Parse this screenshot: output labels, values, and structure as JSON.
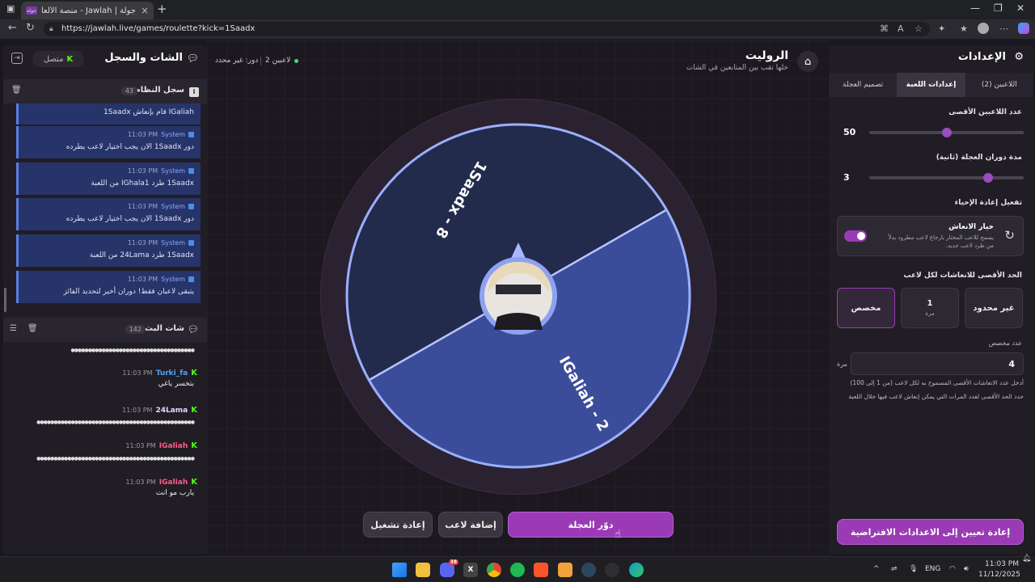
{
  "browser": {
    "tab_title": "جولة | Jawlah - منصة الألعاب التفاعلية",
    "tab_favicon": "جولة",
    "url": "https://jawlah.live/games/roulette?kick=1Saadx"
  },
  "left": {
    "title": "الشات والسجل",
    "online_label": "متصل",
    "system_log": {
      "title": "سجل النظام",
      "count": "43"
    },
    "system_messages": [
      {
        "text": "IGaliah قام بإنعاش 1Saadx",
        "sender": "",
        "time": ""
      },
      {
        "sender": "System",
        "time": "11:03 PM",
        "text": "دور 1Saadx الان يجب اختيار لاعب يطرده"
      },
      {
        "sender": "System",
        "time": "11:03 PM",
        "text": "1Saadx طرد IGhala1 من اللعبة"
      },
      {
        "sender": "System",
        "time": "11:03 PM",
        "text": "دور 1Saadx الان يجب اختيار لاعب يطرده"
      },
      {
        "sender": "System",
        "time": "11:03 PM",
        "text": "1Saadx طرد 24Lama من اللعبة"
      },
      {
        "sender": "System",
        "time": "11:03 PM",
        "text": "يتبقى لاعبان فقط! دوران أخير لتحديد الفائز"
      }
    ],
    "stream_chat": {
      "title": "شات البث",
      "count": "142"
    },
    "chat_messages": [
      {
        "name": "Turki_fa",
        "time": "11:03 PM",
        "text": "بتخسر ياغي",
        "color": "#4aa3ff"
      },
      {
        "name": "24Lama",
        "time": "11:03 PM",
        "text": "",
        "color": "#e8d4ff"
      },
      {
        "name": "IGaliah",
        "time": "11:03 PM",
        "text": "",
        "color": "#ff5c8a"
      },
      {
        "name": "IGaliah",
        "time": "11:03 PM",
        "text": "يارب مو انت",
        "color": "#ff5c8a"
      }
    ]
  },
  "header": {
    "title": "الروليت",
    "subtitle": "خلها تقب بين المتابعين في الشات",
    "players": "2 لاعبين",
    "turn": "دور: غير محدد"
  },
  "wheel": {
    "segments": [
      {
        "label": "1Saadx - 8",
        "color": "#222a4a"
      },
      {
        "label": "IGaliah - 2",
        "color": "#3b4d99"
      }
    ]
  },
  "buttons": {
    "spin": "دوّر العجلة",
    "add_player": "إضافة لاعب",
    "restart": "إعادة تشغيل"
  },
  "settings": {
    "title": "الإعدادات",
    "tabs": [
      "اللاعبين (2)",
      "إعدادات اللعبة",
      "تصميم العجلة"
    ],
    "max_players_label": "عدد اللاعبين الأقصى",
    "max_players_value": "50",
    "max_players_fraction": 0.5,
    "spin_duration_label": "مدة دوران العجلة (ثانية)",
    "spin_duration_value": "3",
    "spin_duration_fraction": 0.23,
    "revive_label": "تفعيل إعادة الإحياء",
    "revive_option_title": "خيار الانعاش",
    "revive_option_desc": "يسمح للاعب المختار بارجاع لاعب مطرود بدلاً من طرد لاعب جديد.",
    "max_revives_label": "الحد الأقصى للانعاشات لكل لاعب",
    "options": [
      {
        "label": "غير محدود",
        "sub": ""
      },
      {
        "label": "1",
        "sub": "مرة"
      },
      {
        "label": "مخصص",
        "sub": ""
      }
    ],
    "custom_count_label": "عدد مخصص",
    "custom_count_value": "4",
    "custom_unit": "مرة",
    "hint1": "أدخل عدد الانعاشات الأقصى المسموح به لكل لاعب (من 1 إلى 100)",
    "hint2": "حدد الحد الأقصى لعدد المرات التي يمكن إنعاش لاعب فيها خلال اللعبة",
    "reset_button": "إعادة تعيين إلى الاعدادات الافتراضية"
  },
  "taskbar": {
    "lang": "ENG",
    "time": "11:03 PM",
    "date": "11/12/2025",
    "discord_badge": "38"
  }
}
